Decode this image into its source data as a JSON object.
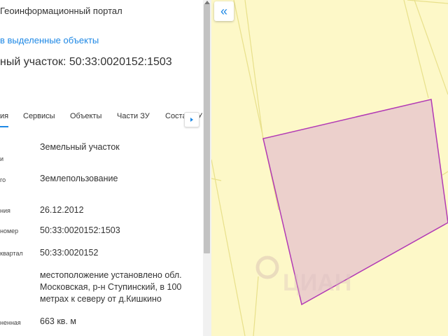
{
  "panel": {
    "portal_title": "Геоинформационный портал",
    "selected_link": "в выделенные объекты",
    "heading": "ный участок: 50:33:0020152:1503",
    "tabs": [
      {
        "label": "ия",
        "active": true
      },
      {
        "label": "Сервисы",
        "active": false
      },
      {
        "label": "Объекты",
        "active": false
      },
      {
        "label": "Части ЗУ",
        "active": false
      },
      {
        "label": "Состав ЗУ",
        "active": false
      }
    ],
    "rows": [
      {
        "label": "и",
        "value": "Земельный участок"
      },
      {
        "label": "го",
        "value": "Землепользование"
      },
      {
        "label": "ния",
        "value": "26.12.2012"
      },
      {
        "label": "номер",
        "value": "50:33:0020152:1503"
      },
      {
        "label": "квартал",
        "value": "50:33:0020152"
      },
      {
        "label": "",
        "value": "местоположение установлено обл. Московская, р-н Ступинский, в 100 метрах к северу от д.Кишкино"
      },
      {
        "label": "ненная",
        "value": "663 кв. м"
      }
    ]
  },
  "map": {
    "collapse_button": "«",
    "watermark": "ЦИАН",
    "colors": {
      "background": "#fdf8c8",
      "parcel_lines": "#e8e08a",
      "selected_fill": "#ecd0cc",
      "selected_stroke": "#b23ab5"
    }
  },
  "colors": {
    "accent": "#1e88e5"
  }
}
